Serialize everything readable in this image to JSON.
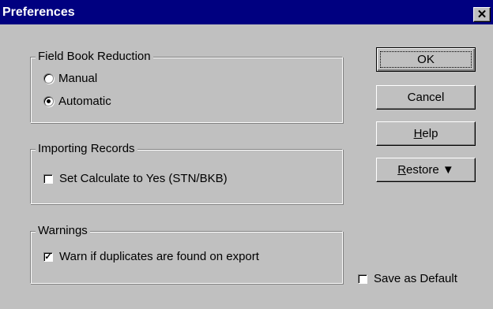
{
  "window": {
    "title": "Preferences",
    "close_glyph": "✕"
  },
  "groups": {
    "field_book": {
      "label": "Field Book Reduction",
      "options": [
        {
          "label": "Manual",
          "checked": false
        },
        {
          "label": "Automatic",
          "checked": true
        }
      ]
    },
    "importing": {
      "label": "Importing Records",
      "checkbox": {
        "label": "Set Calculate to Yes (STN/BKB)",
        "checked": false
      }
    },
    "warnings": {
      "label": "Warnings",
      "checkbox": {
        "label": "Warn if duplicates are found on export",
        "checked": true
      }
    }
  },
  "buttons": {
    "ok": "OK",
    "cancel": "Cancel",
    "help_mnemonic": "H",
    "help_rest": "elp",
    "restore_mnemonic": "R",
    "restore_rest": "estore",
    "restore_arrow": "▼"
  },
  "save_default": {
    "label": "Save as Default",
    "checked": false
  }
}
